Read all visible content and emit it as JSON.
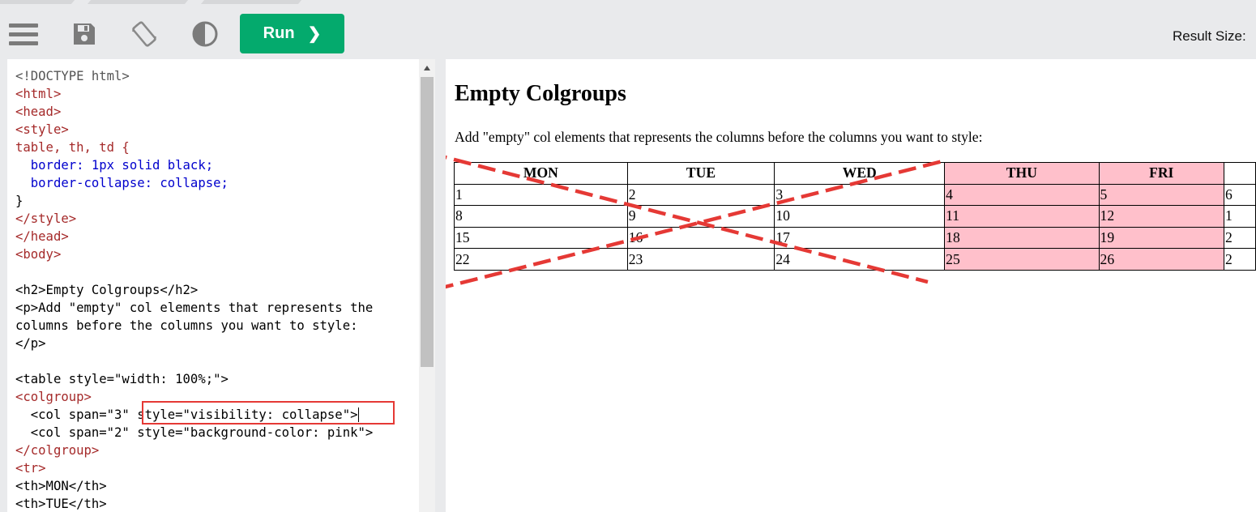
{
  "toolbar": {
    "menu_icon": "hamburger-menu-icon",
    "save_icon": "floppy-disk-icon",
    "rotate_icon": "rotate-device-icon",
    "theme_icon": "contrast-half-circle-icon",
    "run_label": "Run",
    "run_chevron": "❯",
    "result_size_label": "Result Size:"
  },
  "editor": {
    "lines": [
      "<!DOCTYPE html>",
      "<html>",
      "<head>",
      "<style>",
      "table, th, td {",
      "  border: 1px solid black;",
      "  border-collapse: collapse;",
      "}",
      "</style>",
      "</head>",
      "<body>",
      "",
      "<h2>Empty Colgroups</h2>",
      "<p>Add \"empty\" col elements that represents the",
      "columns before the columns you want to style:",
      "</p>",
      "",
      "<table style=\"width: 100%;\">",
      "<colgroup>",
      "  <col span=\"3\" style=\"visibility: collapse\">",
      "  <col span=\"2\" style=\"background-color: pink\">",
      "</colgroup>",
      "<tr>",
      "<th>MON</th>",
      "<th>TUE</th>"
    ]
  },
  "result": {
    "heading": "Empty Colgroups",
    "paragraph": "Add \"empty\" col elements that represents the columns before the columns you want to style:",
    "table": {
      "headers": [
        "MON",
        "TUE",
        "WED",
        "THU",
        "FRI",
        ""
      ],
      "rows": [
        [
          "1",
          "2",
          "3",
          "4",
          "5",
          "6"
        ],
        [
          "8",
          "9",
          "10",
          "11",
          "12",
          "1"
        ],
        [
          "15",
          "16",
          "17",
          "18",
          "19",
          "2"
        ],
        [
          "22",
          "23",
          "24",
          "25",
          "26",
          "2"
        ]
      ],
      "pink_columns": [
        3,
        4
      ],
      "pink_color": "#ffc0cb"
    }
  },
  "colors": {
    "run_button": "#04aa6d",
    "annotation_red": "#e53935",
    "toolbar_bg": "#e9eaec"
  }
}
